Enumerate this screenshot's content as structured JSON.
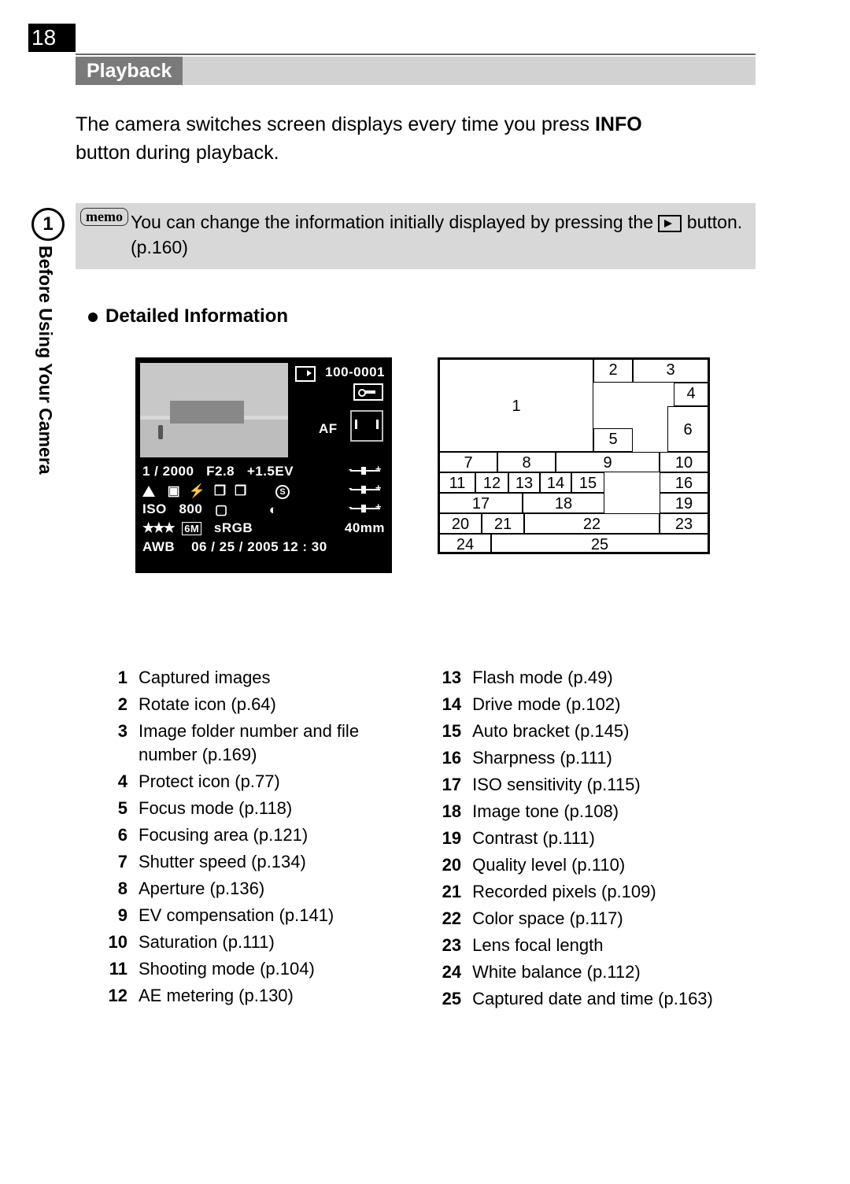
{
  "page": {
    "number": "18",
    "tab_chapter": "1",
    "tab_label": "Before Using Your Camera"
  },
  "section": {
    "title": "Playback"
  },
  "intro": {
    "p1": "The camera switches screen displays every time you press ",
    "btn": "INFO",
    "p2": " button during playback."
  },
  "memo": {
    "label": "memo",
    "t1": "You can change the information initially displayed by pressing the ",
    "t2": " button. (p.160)"
  },
  "subhead": "Detailed Information",
  "lcd": {
    "folder_file": "100-0001",
    "af": "AF",
    "row1": {
      "shutter": "1 / 2000",
      "aperture": "F2.8",
      "ev": "+1.5EV"
    },
    "row2": {
      "circled_s": "S"
    },
    "row3": {
      "iso_label": "ISO",
      "iso_val": "800"
    },
    "row4": {
      "stars": "★★★",
      "pixels": "6M",
      "colorspace": "sRGB",
      "focal": "40mm"
    },
    "row5": {
      "wb": "AWB",
      "datetime": "06 / 25 / 2005  12 : 30"
    }
  },
  "diagram": {
    "c1": "1",
    "c2": "2",
    "c3": "3",
    "c4": "4",
    "c5": "5",
    "c6": "6",
    "c7": "7",
    "c8": "8",
    "c9": "9",
    "c10": "10",
    "c11": "11",
    "c12": "12",
    "c13": "13",
    "c14": "14",
    "c15": "15",
    "c16": "16",
    "c17": "17",
    "c18": "18",
    "c19": "19",
    "c20": "20",
    "c21": "21",
    "c22": "22",
    "c23": "23",
    "c24": "24",
    "c25": "25"
  },
  "legend_left": [
    {
      "n": "1",
      "t": "Captured images"
    },
    {
      "n": "2",
      "t": "Rotate icon (p.64)"
    },
    {
      "n": "3",
      "t": "Image folder number and file number (p.169)"
    },
    {
      "n": "4",
      "t": "Protect icon (p.77)"
    },
    {
      "n": "5",
      "t": "Focus mode (p.118)"
    },
    {
      "n": "6",
      "t": "Focusing area (p.121)"
    },
    {
      "n": "7",
      "t": "Shutter speed (p.134)"
    },
    {
      "n": "8",
      "t": "Aperture (p.136)"
    },
    {
      "n": "9",
      "t": "EV compensation (p.141)"
    },
    {
      "n": "10",
      "t": "Saturation (p.111)"
    },
    {
      "n": "11",
      "t": "Shooting mode (p.104)"
    },
    {
      "n": "12",
      "t": "AE metering (p.130)"
    }
  ],
  "legend_right": [
    {
      "n": "13",
      "t": "Flash mode (p.49)"
    },
    {
      "n": "14",
      "t": "Drive mode (p.102)"
    },
    {
      "n": "15",
      "t": "Auto bracket (p.145)"
    },
    {
      "n": "16",
      "t": "Sharpness (p.111)"
    },
    {
      "n": "17",
      "t": "ISO sensitivity (p.115)"
    },
    {
      "n": "18",
      "t": "Image tone (p.108)"
    },
    {
      "n": "19",
      "t": "Contrast (p.111)"
    },
    {
      "n": "20",
      "t": "Quality level (p.110)"
    },
    {
      "n": "21",
      "t": "Recorded pixels (p.109)"
    },
    {
      "n": "22",
      "t": "Color space (p.117)"
    },
    {
      "n": "23",
      "t": "Lens focal length"
    },
    {
      "n": "24",
      "t": "White balance (p.112)"
    },
    {
      "n": "25",
      "t": "Captured date and time (p.163)"
    }
  ]
}
